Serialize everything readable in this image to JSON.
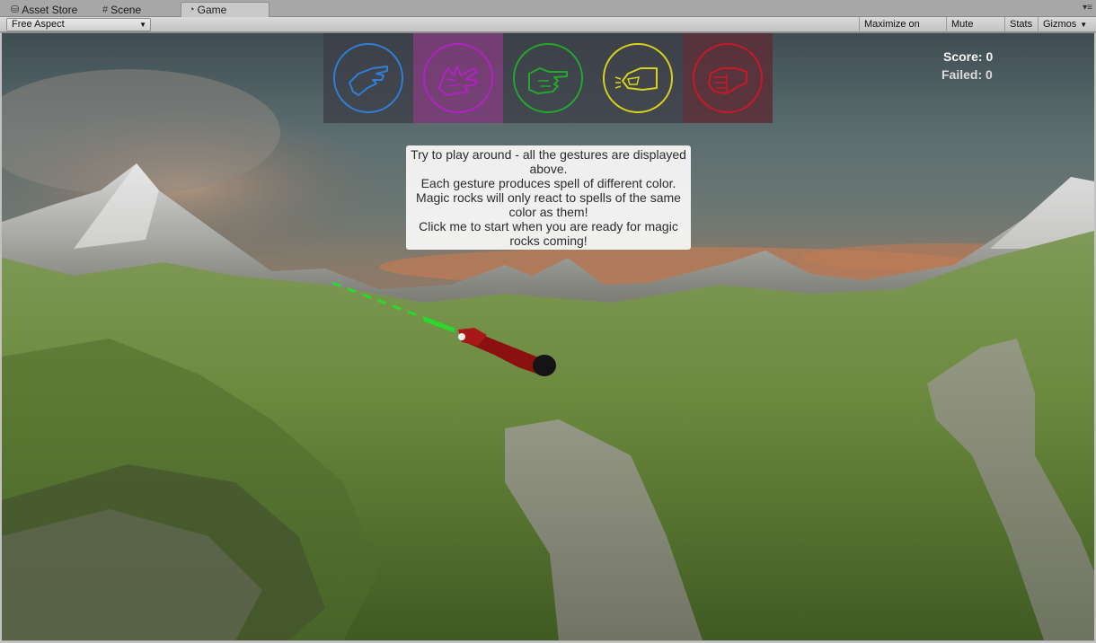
{
  "tabs": {
    "asset_store": "Asset Store",
    "scene": "Scene",
    "game": "Game",
    "menu": "▾≡"
  },
  "toolbar": {
    "aspect": "Free Aspect",
    "maximize": "Maximize on Play",
    "mute": "Mute audio",
    "stats": "Stats",
    "gizmos": "Gizmos"
  },
  "hud": {
    "score": "Score: 0",
    "failed": "Failed: 0"
  },
  "gestures": [
    {
      "name": "open-palm",
      "color": "#2f7fd6"
    },
    {
      "name": "spread-fingers",
      "color": "#b023c2"
    },
    {
      "name": "pointing",
      "color": "#22a82a"
    },
    {
      "name": "pinch",
      "color": "#d8d21a"
    },
    {
      "name": "fist",
      "color": "#c8192a"
    }
  ],
  "instructions": {
    "line1": "Try to play around - all the gestures are displayed above.",
    "line2": "Each gesture produces spell of different color.",
    "line3": "Magic rocks will only react to spells of the same color as them!",
    "line4": "Click me to start when you are ready for magic rocks coming!"
  },
  "colors": {
    "spell_beam": "#2bd82b",
    "hand": "#8b1010"
  }
}
